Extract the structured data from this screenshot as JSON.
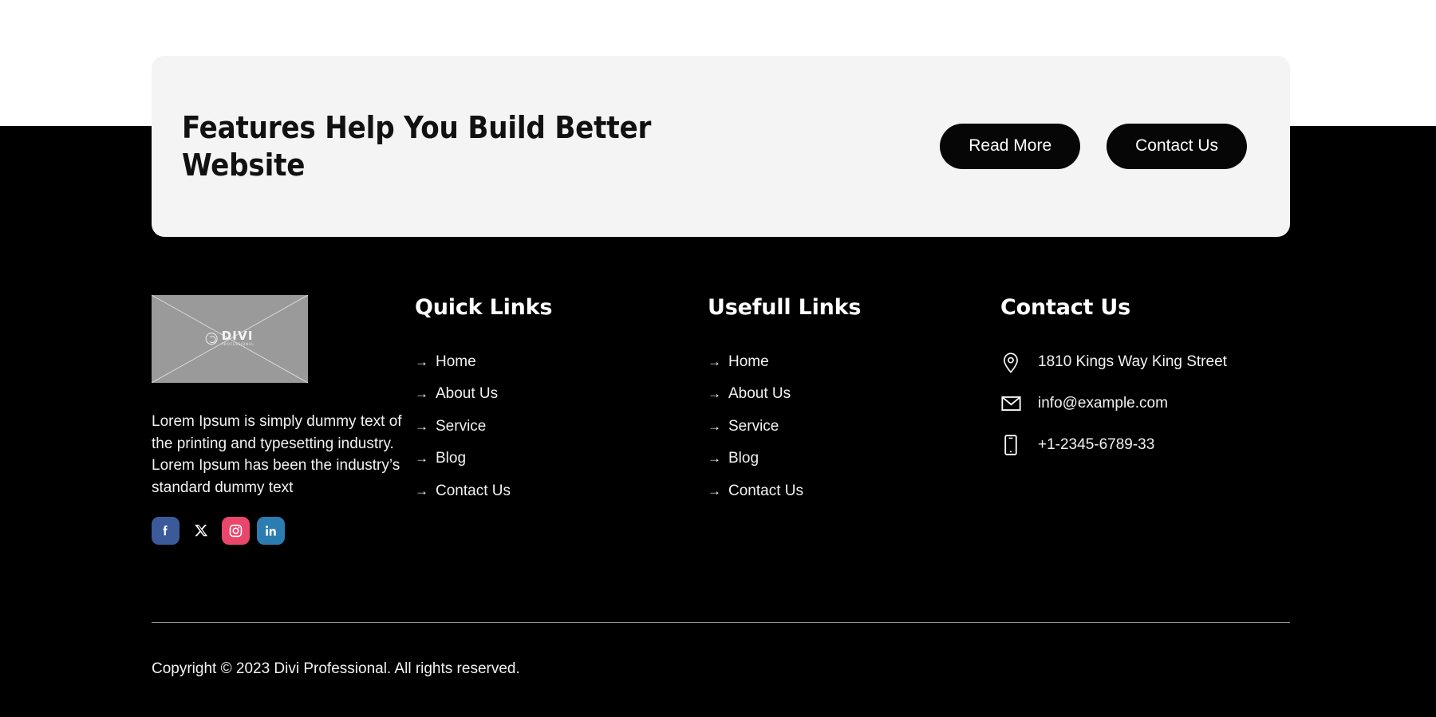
{
  "cta": {
    "title": "Features Help You Build Better Website",
    "buttons": [
      {
        "label": "Read More",
        "name": "read-more-button"
      },
      {
        "label": "Contact Us",
        "name": "contact-us-button"
      }
    ]
  },
  "footer": {
    "brand": {
      "logo_alt_word": "DIVI",
      "logo_alt_sub": "PROFESSIONAL",
      "description": "Lorem Ipsum is simply dummy text of the printing and typesetting industry. Lorem Ipsum has been the industry’s standard dummy text",
      "socials": [
        {
          "name": "facebook-icon",
          "label": "Facebook",
          "color": "#3b5a9a"
        },
        {
          "name": "x-twitter-icon",
          "label": "X",
          "color": "#000000"
        },
        {
          "name": "instagram-icon",
          "label": "Instagram",
          "color": "#e8476b"
        },
        {
          "name": "linkedin-icon",
          "label": "LinkedIn",
          "color": "#2b7cb0"
        }
      ]
    },
    "quick_links": {
      "title": "Quick Links",
      "items": [
        "Home",
        "About Us",
        "Service",
        "Blog",
        "Contact Us"
      ]
    },
    "usefull_links": {
      "title": "Usefull Links",
      "items": [
        "Home",
        "About Us",
        "Service",
        "Blog",
        "Contact Us"
      ]
    },
    "contact": {
      "title": "Contact Us",
      "items": [
        {
          "icon": "map-pin-icon",
          "text": "1810 Kings Way King Street"
        },
        {
          "icon": "envelope-icon",
          "text": "info@example.com"
        },
        {
          "icon": "mobile-phone-icon",
          "text": "+1-2345-6789-33"
        }
      ]
    },
    "copyright": "Copyright © 2023 Divi Professional. All rights reserved.",
    "arrow_glyph": "→"
  },
  "colors": {
    "page_background": "#ffffff",
    "footer_background": "#000000",
    "card_background": "#f4f4f4",
    "button_background": "#060606",
    "text_light": "#f2f2f2",
    "divider": "#8e8e8e",
    "placeholder_gray": "#9a9a9a"
  }
}
